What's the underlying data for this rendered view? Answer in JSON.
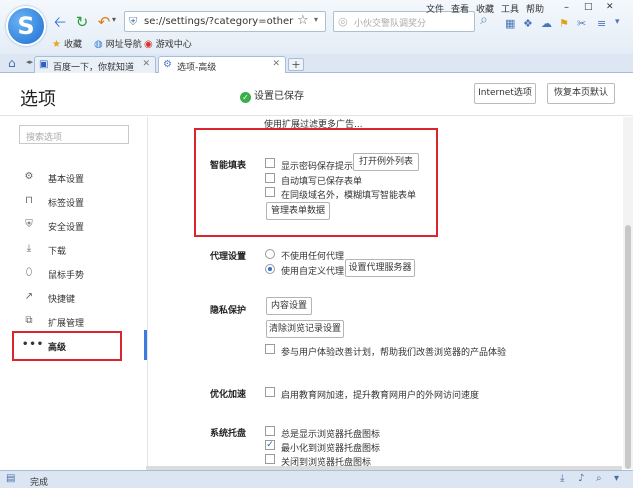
{
  "browser": {
    "logo_letter": "S",
    "address": "se://settings/?category=other",
    "search_placeholder": "小伙交警队调奖分",
    "menu": [
      "文件",
      "查看",
      "收藏",
      "工具",
      "帮助"
    ],
    "bookmarks": [
      {
        "icon": "star-icon",
        "label": "收藏"
      },
      {
        "icon": "globe-icon",
        "label": "网址导航"
      },
      {
        "icon": "game-icon",
        "label": "游戏中心"
      }
    ],
    "tabs": [
      {
        "label": "百度一下，你就知道",
        "active": false
      },
      {
        "label": "选项-高级",
        "active": true
      }
    ],
    "new_tab": "+",
    "status_text": "完成"
  },
  "header": {
    "title": "选项",
    "saved_status": "设置已保存",
    "internet_options_label": "Internet选项",
    "restore_default_label": "恢复本页默认"
  },
  "sidebar": {
    "search_placeholder": "搜索选项",
    "items": [
      {
        "icon": "gear-icon",
        "label": "基本设置"
      },
      {
        "icon": "tab-icon",
        "label": "标签设置"
      },
      {
        "icon": "shield-icon",
        "label": "安全设置"
      },
      {
        "icon": "download-icon",
        "label": "下载"
      },
      {
        "icon": "mouse-gesture-icon",
        "label": "鼠标手势"
      },
      {
        "icon": "shortcut-icon",
        "label": "快捷键"
      },
      {
        "icon": "extension-icon",
        "label": "扩展管理"
      },
      {
        "icon": "more-icon",
        "label": "高级",
        "active": true
      }
    ]
  },
  "main": {
    "ad_filter_text": "使用扩展过滤更多广告...",
    "smart_fill": {
      "label": "智能填表",
      "options": [
        {
          "label": "显示密码保存提示",
          "checked": false
        },
        {
          "label": "自动填写已保存表单",
          "checked": false
        },
        {
          "label": "在同级域名外，模糊填写智能表单",
          "checked": false
        }
      ],
      "exception_button": "打开例外列表",
      "manage_button": "管理表单数据"
    },
    "proxy": {
      "label": "代理设置",
      "options": [
        {
          "label": "不使用任何代理",
          "checked": false
        },
        {
          "label": "使用自定义代理",
          "checked": true
        }
      ],
      "setup_button": "设置代理服务器"
    },
    "privacy": {
      "label": "隐私保护",
      "content_button": "内容设置",
      "clear_history_button": "清除浏览记录设置",
      "experience_label": "参与用户体验改善计划，帮助我们改善浏览器的产品体验",
      "experience_checked": false
    },
    "acceleration": {
      "label": "优化加速",
      "option_label": "启用教育网加速，提升教育网用户的外网访问速度",
      "checked": false
    },
    "tray": {
      "label": "系统托盘",
      "options": [
        {
          "label": "总是显示浏览器托盘图标",
          "checked": false
        },
        {
          "label": "最小化到浏览器托盘图标",
          "checked": true
        },
        {
          "label": "关闭到浏览器托盘图标",
          "checked": false
        }
      ]
    }
  }
}
